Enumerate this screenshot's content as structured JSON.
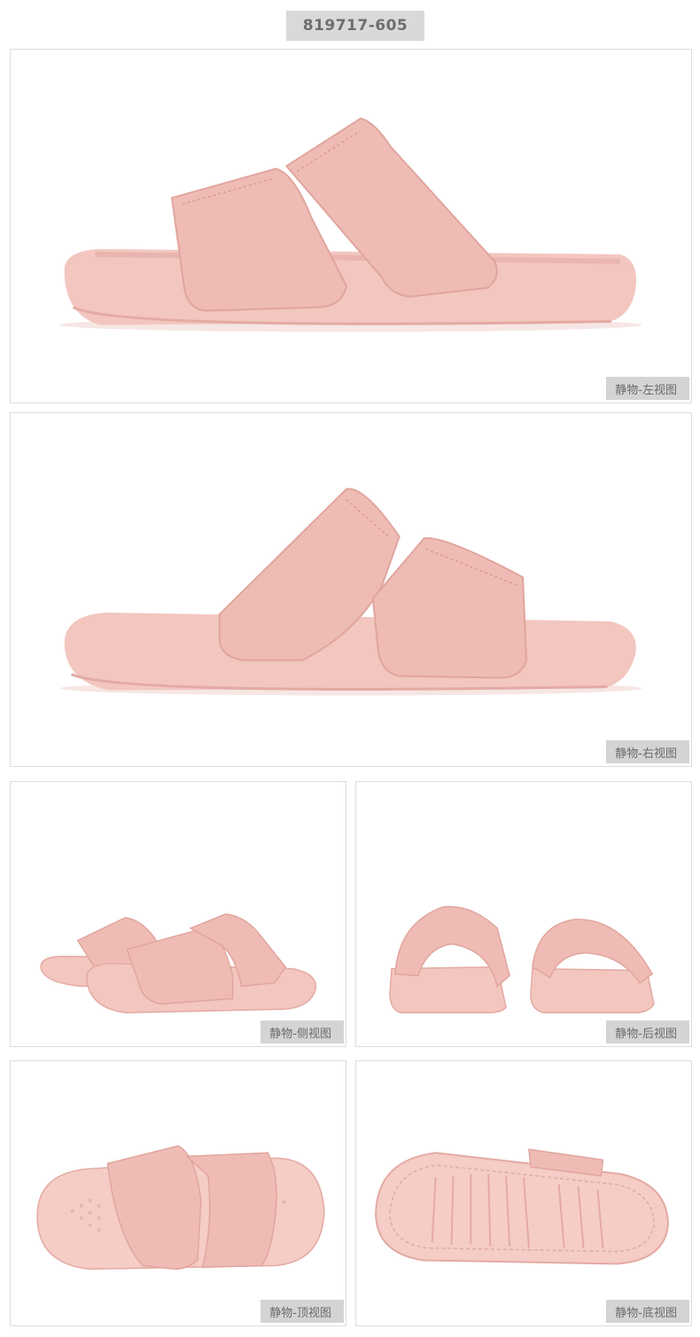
{
  "product": {
    "code": "819717-605"
  },
  "views": [
    {
      "label": "静物-左视图",
      "icon": "sandal-left-view-image"
    },
    {
      "label": "静物-右视图",
      "icon": "sandal-right-view-image"
    },
    {
      "label": "静物-侧视图",
      "icon": "sandal-side-view-image"
    },
    {
      "label": "静物-后视图",
      "icon": "sandal-back-view-image"
    },
    {
      "label": "静物-顶视图",
      "icon": "sandal-top-view-image"
    },
    {
      "label": "静物-底视图",
      "icon": "sandal-bottom-view-image"
    }
  ],
  "colors": {
    "sandal": "#f3c6c0",
    "sandal_shadow": "#e3aaa3",
    "strap": "#efbcb5",
    "stitch": "#d99b93",
    "badge": "#d9d9d9",
    "tag": "#d4d4d4"
  }
}
